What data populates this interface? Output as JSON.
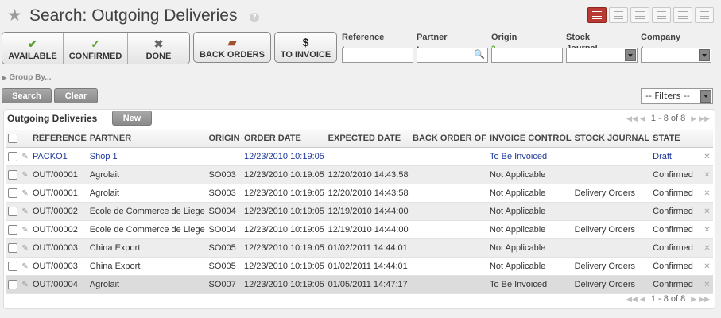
{
  "header": {
    "title": "Search: Outgoing Deliveries",
    "help": "?",
    "views": [
      "list-view-icon",
      "form-view-icon",
      "graph-view-icon",
      "calendar-view-icon",
      "gantt-view-icon",
      "kanban-view-icon"
    ]
  },
  "filter_buttons": [
    {
      "label": "AVAILABLE",
      "icon": "✔"
    },
    {
      "label": "CONFIRMED",
      "icon": "✓"
    },
    {
      "label": "DONE",
      "icon": "✖"
    }
  ],
  "back_orders": {
    "label": "BACK ORDERS",
    "icon": "▰"
  },
  "to_invoice": {
    "label": "TO INVOICE",
    "icon": "$"
  },
  "search_fields": {
    "reference": "Reference :",
    "partner": "Partner :",
    "origin": "Origin",
    "origin_help": "?",
    "origin_colon": ":",
    "stock_journal": "Stock Journal :",
    "company": "Company :"
  },
  "group_by": "Group By...",
  "actions": {
    "search": "Search",
    "clear": "Clear"
  },
  "filters_select": "-- Filters --",
  "list": {
    "title": "Outgoing Deliveries",
    "new_label": "New",
    "pager": "1 - 8 of 8",
    "columns": [
      "REFERENCE",
      "PARTNER",
      "ORIGIN",
      "ORDER DATE",
      "EXPECTED DATE",
      "BACK ORDER OF",
      "INVOICE CONTROL",
      "STOCK JOURNAL",
      "STATE"
    ],
    "rows": [
      [
        "PACKO1",
        "Shop 1",
        "",
        "12/23/2010 10:19:05",
        "",
        "",
        "To Be Invoiced",
        "",
        "Draft"
      ],
      [
        "OUT/00001",
        "Agrolait",
        "SO003",
        "12/23/2010 10:19:05",
        "12/20/2010 14:43:58",
        "",
        "Not Applicable",
        "",
        "Confirmed"
      ],
      [
        "OUT/00001",
        "Agrolait",
        "SO003",
        "12/23/2010 10:19:05",
        "12/20/2010 14:43:58",
        "",
        "Not Applicable",
        "Delivery Orders",
        "Confirmed"
      ],
      [
        "OUT/00002",
        "Ecole de Commerce de Liege",
        "SO004",
        "12/23/2010 10:19:05",
        "12/19/2010 14:44:00",
        "",
        "Not Applicable",
        "",
        "Confirmed"
      ],
      [
        "OUT/00002",
        "Ecole de Commerce de Liege",
        "SO004",
        "12/23/2010 10:19:05",
        "12/19/2010 14:44:00",
        "",
        "Not Applicable",
        "Delivery Orders",
        "Confirmed"
      ],
      [
        "OUT/00003",
        "China Export",
        "SO005",
        "12/23/2010 10:19:05",
        "01/02/2011 14:44:01",
        "",
        "Not Applicable",
        "",
        "Confirmed"
      ],
      [
        "OUT/00003",
        "China Export",
        "SO005",
        "12/23/2010 10:19:05",
        "01/02/2011 14:44:01",
        "",
        "Not Applicable",
        "Delivery Orders",
        "Confirmed"
      ],
      [
        "OUT/00004",
        "Agrolait",
        "SO007",
        "12/23/2010 10:19:05",
        "01/05/2011 14:47:17",
        "",
        "To Be Invoiced",
        "Delivery Orders",
        "Confirmed"
      ]
    ]
  },
  "colors": {
    "accent": "#b93a32",
    "link": "#1f3a9c",
    "available_icon": "#5a9e2b"
  }
}
